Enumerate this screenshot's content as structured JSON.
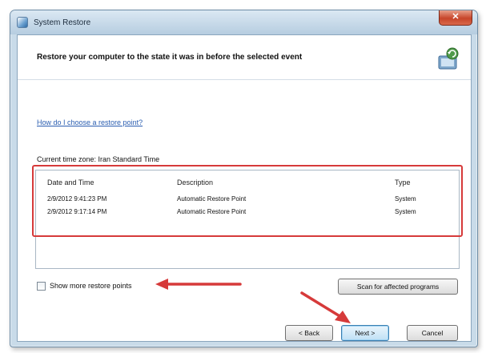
{
  "window": {
    "title": "System Restore",
    "close_symbol": "✕"
  },
  "header": {
    "title": "Restore your computer to the state it was in before the selected event"
  },
  "help_link": "How do I choose a restore point?",
  "timezone_label": "Current time zone: Iran Standard Time",
  "table": {
    "columns": [
      "Date and Time",
      "Description",
      "Type"
    ],
    "rows": [
      [
        "2/9/2012 9:41:23 PM",
        "Automatic Restore Point",
        "System"
      ],
      [
        "2/9/2012 9:17:14 PM",
        "Automatic Restore Point",
        "System"
      ]
    ]
  },
  "options": {
    "show_more_label": "Show more restore points",
    "show_more_checked": false
  },
  "buttons": {
    "scan": "Scan for affected programs",
    "back": "< Back",
    "next": "Next >",
    "cancel": "Cancel"
  },
  "colors": {
    "annotation_red": "#d63a3a",
    "window_frame": "#c9dbe9",
    "link_blue": "#2a5db0"
  },
  "icons": [
    "system-restore-icon",
    "close-icon",
    "restore-graphic-icon",
    "annotation-arrow-icon"
  ]
}
